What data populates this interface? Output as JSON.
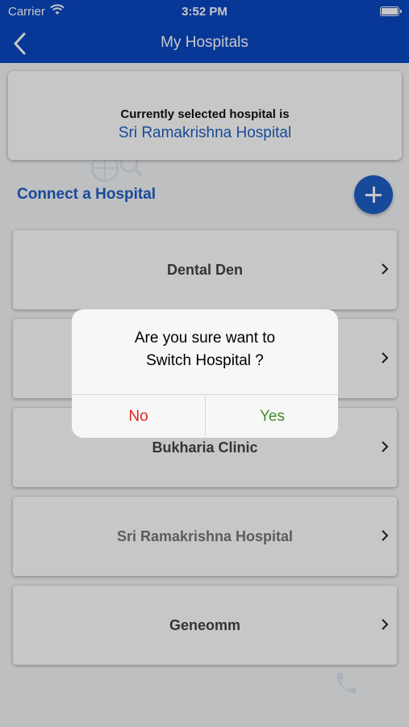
{
  "status_bar": {
    "carrier": "Carrier",
    "time": "3:52 PM"
  },
  "nav": {
    "title": "My Hospitals",
    "back_icon": "chevron-left-icon"
  },
  "current": {
    "label": "Currently selected hospital is",
    "hospital": "Sri Ramakrishna Hospital"
  },
  "connect": {
    "label": "Connect a Hospital",
    "add_icon": "plus-icon"
  },
  "hospitals": [
    {
      "name": "Dental Den"
    },
    {
      "name": ""
    },
    {
      "name": "Bukharia Clinic"
    },
    {
      "name": "Sri Ramakrishna Hospital"
    },
    {
      "name": "Geneomm"
    }
  ],
  "alert": {
    "message_line1": "Are you sure want to",
    "message_line2": "Switch Hospital ?",
    "no_label": "No",
    "yes_label": "Yes"
  },
  "colors": {
    "brand": "#0a47c2",
    "accent": "#1f5fc7",
    "no": "#e3261c",
    "yes": "#3e8e2d"
  }
}
